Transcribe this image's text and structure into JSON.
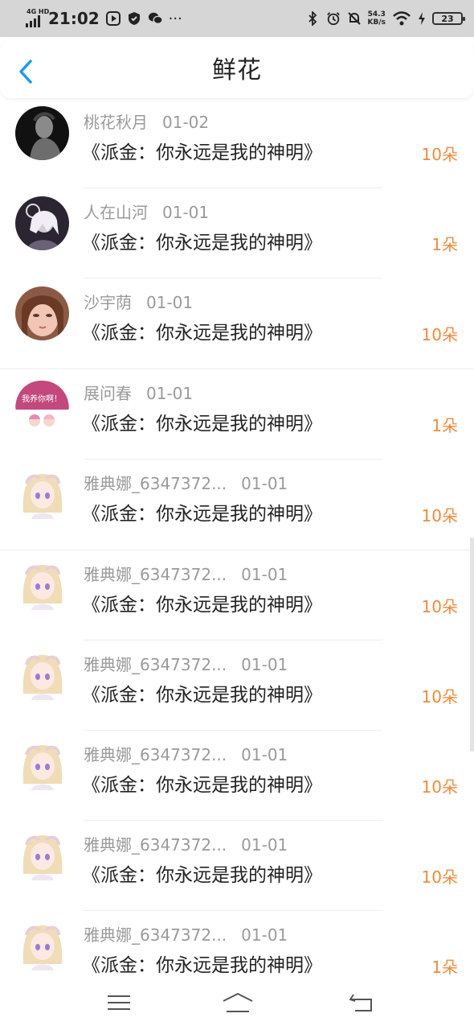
{
  "status_bar": {
    "network": "4G HD",
    "time": "21:02",
    "speed_value": "54.3",
    "speed_unit": "KB/s",
    "battery": "23",
    "icons": [
      "signal-icon",
      "video-icon",
      "shield-icon",
      "wechat-icon",
      "more-icon",
      "bluetooth-icon",
      "alarm-icon",
      "mute-icon",
      "wifi-icon",
      "charging-icon",
      "battery-icon"
    ]
  },
  "header": {
    "title": "鲜花",
    "back_icon": "back-arrow-icon"
  },
  "colors": {
    "accent": "#1a9bf0",
    "count": "#f08a3c",
    "meta": "#9a9a9a"
  },
  "items": [
    {
      "name": "桃花秋月",
      "date": "01-02",
      "book": "《派金：你永远是我的神明》",
      "count": "10朵",
      "avatar": "dark-silhouette"
    },
    {
      "name": "人在山河",
      "date": "01-01",
      "book": "《派金：你永远是我的神明》",
      "count": "1朵",
      "avatar": "anime-moon"
    },
    {
      "name": "沙宇荫",
      "date": "01-01",
      "book": "《派金：你永远是我的神明》",
      "count": "10朵",
      "avatar": "selfie-photo"
    },
    {
      "name": "展问春",
      "date": "01-01",
      "book": "《派金：你永远是我的神明》",
      "count": "1朵",
      "avatar": "sticker",
      "avatar_text": "我养你啊！"
    },
    {
      "name": "雅典娜_6347372...",
      "date": "01-01",
      "book": "《派金：你永远是我的神明》",
      "count": "10朵",
      "avatar": "anime-girl"
    },
    {
      "name": "雅典娜_6347372...",
      "date": "01-01",
      "book": "《派金：你永远是我的神明》",
      "count": "10朵",
      "avatar": "anime-girl"
    },
    {
      "name": "雅典娜_6347372...",
      "date": "01-01",
      "book": "《派金：你永远是我的神明》",
      "count": "10朵",
      "avatar": "anime-girl"
    },
    {
      "name": "雅典娜_6347372...",
      "date": "01-01",
      "book": "《派金：你永远是我的神明》",
      "count": "10朵",
      "avatar": "anime-girl"
    },
    {
      "name": "雅典娜_6347372...",
      "date": "01-01",
      "book": "《派金：你永远是我的神明》",
      "count": "10朵",
      "avatar": "anime-girl"
    },
    {
      "name": "雅典娜_6347372...",
      "date": "01-01",
      "book": "《派金：你永远是我的神明》",
      "count": "1朵",
      "avatar": "anime-girl"
    }
  ],
  "nav_bar": {
    "icons": [
      "menu-icon",
      "home-icon",
      "back-icon"
    ]
  }
}
